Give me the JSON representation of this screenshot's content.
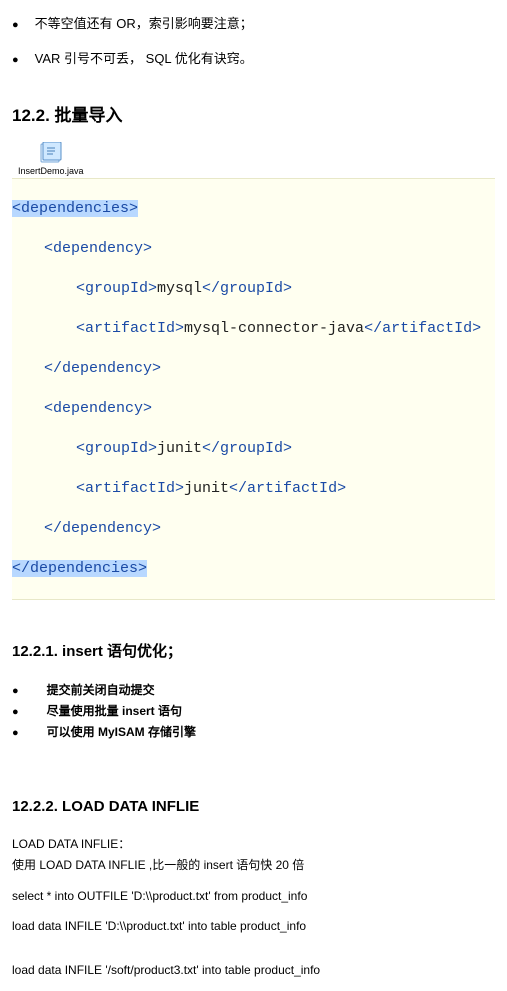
{
  "top_bullets": [
    "不等空值还有 OR，索引影响要注意；",
    "VAR 引号不可丢， SQL 优化有诀窍。"
  ],
  "section_12_2": {
    "title": "12.2. 批量导入",
    "file_label": "InsertDemo.java"
  },
  "code": {
    "l1_open": "<dependencies>",
    "l2_open": "<dependency>",
    "l3a_open": "<groupId>",
    "l3a_text": "mysql",
    "l3a_close": "</groupId>",
    "l3b_open": "<artifactId>",
    "l3b_text": "mysql-connector-java",
    "l3b_close": "</artifactId>",
    "l2_close": "</dependency>",
    "l4_open": "<dependency>",
    "l5a_open": "<groupId>",
    "l5a_text": "junit",
    "l5a_close": "</groupId>",
    "l5b_open": "<artifactId>",
    "l5b_text": "junit",
    "l5b_close": "</artifactId>",
    "l4_close": "</dependency>",
    "l1_close": "</dependencies>"
  },
  "section_12_2_1": {
    "title": "12.2.1.    insert 语句优化；",
    "bullets": [
      "提交前关闭自动提交",
      "尽量使用批量 insert 语句",
      "可以使用 MyISAM 存储引擎"
    ]
  },
  "section_12_2_2": {
    "title": "12.2.2.    LOAD DATA INFLIE",
    "p1": "LOAD DATA INFLIE：",
    "p2": "使用 LOAD DATA INFLIE ,比一般的 insert 语句快 20 倍",
    "p3": "select * into OUTFILE 'D:\\\\product.txt' from product_info",
    "p4": "load data INFILE 'D:\\\\product.txt' into table product_info",
    "p5": "load data INFILE '/soft/product3.txt' into table product_info"
  }
}
